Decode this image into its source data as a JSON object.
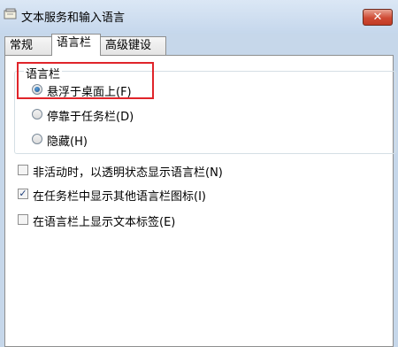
{
  "window": {
    "title": "文本服务和输入语言",
    "close_glyph": "✕"
  },
  "tabs": [
    {
      "label": "常规"
    },
    {
      "label": "语言栏"
    },
    {
      "label": "高级键设置"
    }
  ],
  "language_bar": {
    "group_title": "语言栏",
    "options": [
      {
        "label": "悬浮于桌面上(F)",
        "checked": true
      },
      {
        "label": "停靠于任务栏(D)",
        "checked": false
      },
      {
        "label": "隐藏(H)",
        "checked": false
      }
    ]
  },
  "checkboxes": [
    {
      "label": "非活动时，以透明状态显示语言栏(N)",
      "checked": false
    },
    {
      "label": "在任务栏中显示其他语言栏图标(I)",
      "checked": true
    },
    {
      "label": "在语言栏上显示文本标签(E)",
      "checked": false
    }
  ],
  "colors": {
    "highlight_border": "#e0242a",
    "radio_selected": "#1b4f8f"
  }
}
